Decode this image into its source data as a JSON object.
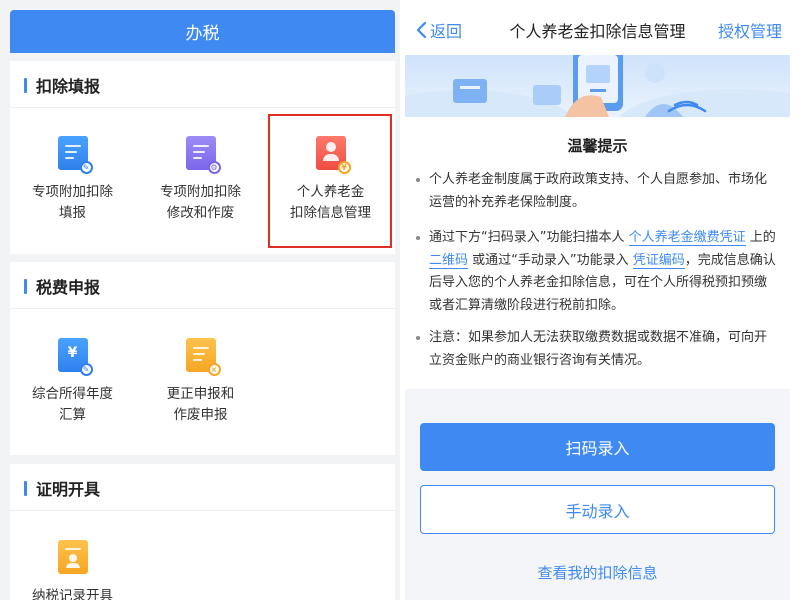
{
  "left": {
    "header_title": "办税",
    "sections": [
      {
        "title": "扣除填报",
        "tiles": [
          {
            "line1": "专项附加扣除",
            "line2": "填报",
            "icon": "document-edit-icon"
          },
          {
            "line1": "专项附加扣除",
            "line2": "修改和作废",
            "icon": "document-settings-icon"
          },
          {
            "line1": "个人养老金",
            "line2": "扣除信息管理",
            "icon": "pension-card-icon"
          }
        ]
      },
      {
        "title": "税费申报",
        "tiles": [
          {
            "line1": "综合所得年度",
            "line2": "汇算",
            "icon": "yuan-document-icon"
          },
          {
            "line1": "更正申报和",
            "line2": "作废申报",
            "icon": "correction-document-icon"
          }
        ]
      },
      {
        "title": "证明开具",
        "tiles": [
          {
            "line1": "纳税记录开具",
            "line2": "",
            "icon": "tax-record-icon"
          }
        ]
      }
    ]
  },
  "right": {
    "nav": {
      "back_label": "返回",
      "title": "个人养老金扣除信息管理",
      "right_label": "授权管理"
    },
    "tip_title": "温馨提示",
    "para1": "个人养老金制度属于政府政策支持、个人自愿参加、市场化运营的补充养老保险制度。",
    "para2": {
      "t1": "通过下方“扫码录入”功能扫描本人",
      "link1": "个人养老金缴费凭证",
      "t2": "上的",
      "link2": "二维码",
      "t3": "或通过“手动录入”功能录入",
      "link3": "凭证编码",
      "t4": "，完成信息确认后导入您的个人养老金扣除信息，可在个人所得税预扣预缴或者汇算清缴阶段进行税前扣除。"
    },
    "para3": "注意：如果参加人无法获取缴费数据或数据不准确，可向开立资金账户的商业银行咨询有关情况。",
    "btn_scan": "扫码录入",
    "btn_manual": "手动录入",
    "link_view": "查看我的扣除信息"
  },
  "colors": {
    "accent": "#3e8af2",
    "highlight": "#e02e24"
  }
}
